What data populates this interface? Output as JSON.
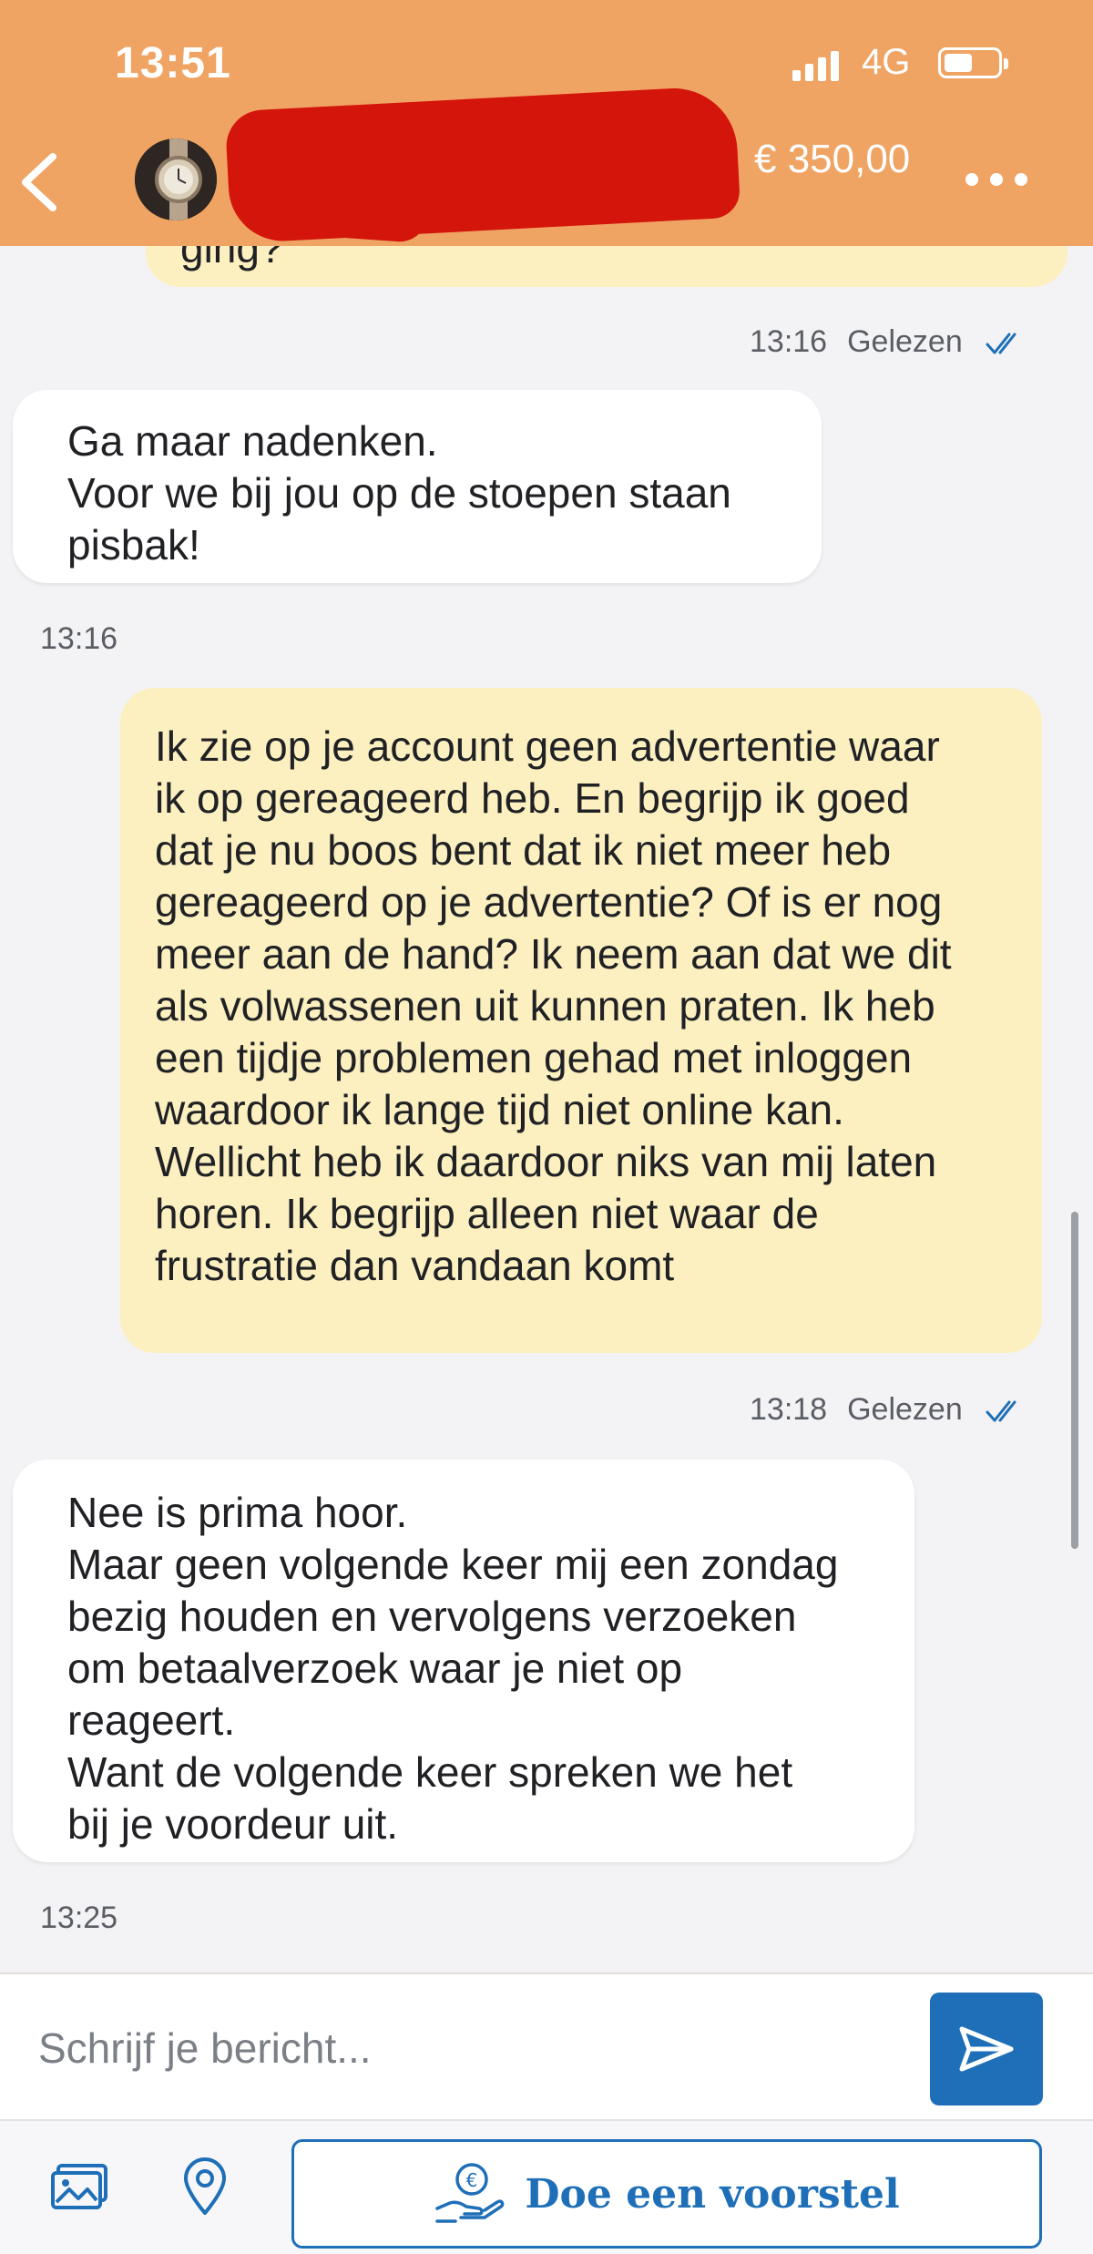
{
  "status_bar": {
    "time": "13:51",
    "network": "4G"
  },
  "header": {
    "price": "€ 350,00"
  },
  "chat": {
    "previous_fragment": "ging?",
    "messages": [
      {
        "side": "out",
        "time": "13:16",
        "status": "Gelezen"
      },
      {
        "side": "in",
        "lines": [
          "Ga maar nadenken.",
          "Voor we bij jou op de stoepen staan",
          "pisbak!"
        ],
        "time": "13:16"
      },
      {
        "side": "out",
        "lines": [
          "Ik zie op je account geen advertentie waar",
          "ik op gereageerd heb. En begrijp ik goed",
          "dat je nu boos bent dat ik niet meer heb",
          "gereageerd op je advertentie? Of is er nog",
          "meer aan de hand? Ik neem aan dat we dit",
          "als volwassenen uit kunnen praten. Ik heb",
          "een tijdje problemen gehad met inloggen",
          "waardoor ik lange tijd niet online kan.",
          "Wellicht heb ik daardoor niks van mij laten",
          "horen. Ik begrijp alleen niet waar de",
          "frustratie dan vandaan komt"
        ],
        "time": "13:18",
        "status": "Gelezen"
      },
      {
        "side": "in",
        "lines": [
          "Nee is prima hoor.",
          "Maar geen volgende keer mij een zondag",
          "bezig houden en vervolgens verzoeken",
          "om betaalverzoek waar je niet op",
          "reageert.",
          "Want de volgende keer spreken we het",
          "bij je voordeur uit."
        ],
        "time": "13:25"
      }
    ]
  },
  "composer": {
    "placeholder": "Schrijf je bericht..."
  },
  "toolbar": {
    "offer_label": "Doe een voorstel"
  },
  "colors": {
    "header": "#efa463",
    "accent": "#1e6fb7",
    "outgoing_bubble": "#fcefc0",
    "incoming_bubble": "#ffffff",
    "redaction": "#d4150c"
  },
  "icons": [
    "chevron-left-icon",
    "watch-avatar",
    "more-dots-icon",
    "double-check-icon",
    "send-icon",
    "photos-icon",
    "location-pin-icon",
    "hand-euro-icon"
  ]
}
